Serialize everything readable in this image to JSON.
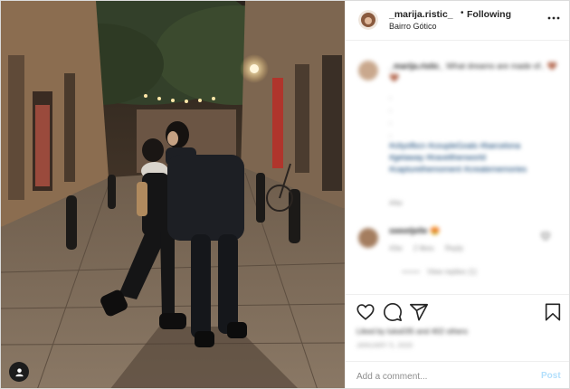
{
  "header": {
    "username": "_marija.ristic_",
    "separator": "•",
    "follow_status": "Following",
    "location": "Bairro Gótico"
  },
  "caption": {
    "username": "_marija.ristic_",
    "text": "What dreams are made of..",
    "emoji": "🤎🤎",
    "dots": [
      ".",
      ".",
      ".",
      "."
    ],
    "hashtags": "#cityofbcn #coupleGoals #barcelona #getaway #travelthenworld #capturethemoment #creatememories",
    "time": "44w"
  },
  "comment": {
    "username": "sweetjelle",
    "emoji": "😍",
    "time": "43w",
    "likes": "2 likes",
    "reply": "Reply",
    "view_replies": "View replies (1)"
  },
  "actions": {
    "icons": [
      "heart-icon",
      "comment-icon",
      "share-icon",
      "bookmark-icon"
    ]
  },
  "likes_text": "Liked by luka035 and 402 others",
  "date": "JANUARY 5, 2020",
  "add_comment": {
    "placeholder": "Add a comment...",
    "post_label": "Post"
  },
  "colors": {
    "link": "#00376b",
    "muted": "#8e8e8e",
    "post_button_disabled": "#b2dffc",
    "border": "#efefef"
  }
}
